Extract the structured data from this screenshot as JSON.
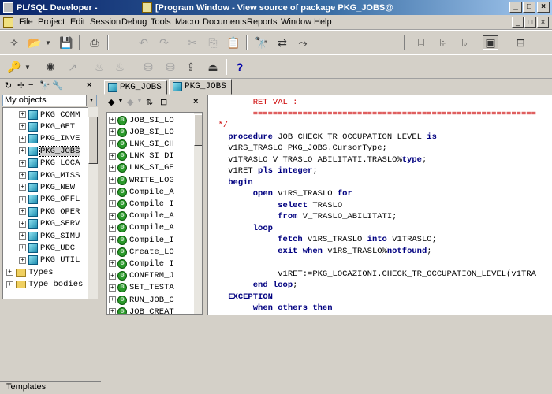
{
  "window": {
    "app_title": "PL/SQL Developer -",
    "doc_title": "[Program Window - View source of package PKG_JOBS@",
    "title_buttons": [
      "_",
      "□",
      "×"
    ]
  },
  "menu": [
    "File",
    "Project",
    "Edit",
    "Session",
    "Debug",
    "Tools",
    "Macro",
    "Documents",
    "Reports",
    "Window",
    "Help"
  ],
  "mdi_buttons": [
    "_",
    "□",
    "×"
  ],
  "toolbar1": [
    "new-icon",
    "open-icon",
    "dropdown-icon",
    "save-icon",
    "print-icon",
    "undo-icon",
    "redo-icon",
    "cut-icon",
    "copy-icon",
    "paste-icon",
    "find-icon",
    "replace-icon",
    "find-next-icon",
    "tool1-icon",
    "tool2-icon",
    "tool3-icon",
    "window-list-icon"
  ],
  "toolbar2": [
    "key-icon",
    "dropdown-icon",
    "settings-icon",
    "disabled-icon",
    "cup-icon",
    "cup2-icon",
    "db-icon",
    "export-icon",
    "import-icon",
    "help-icon"
  ],
  "help_glyph": "?",
  "object_browser": {
    "selector": "My objects",
    "tree": [
      {
        "label": "PKG_COMM",
        "type": "package"
      },
      {
        "label": "PKG_GET",
        "type": "package"
      },
      {
        "label": "PKG_INVE",
        "type": "package"
      },
      {
        "label": "PKG_JOBS",
        "type": "package",
        "selected": true
      },
      {
        "label": "PKG_LOCA",
        "type": "package"
      },
      {
        "label": "PKG_MISS",
        "type": "package"
      },
      {
        "label": "PKG_NEW",
        "type": "package"
      },
      {
        "label": "PKG_OFFL",
        "type": "package"
      },
      {
        "label": "PKG_OPER",
        "type": "package"
      },
      {
        "label": "PKG_SERV",
        "type": "package"
      },
      {
        "label": "PKG_SIMU",
        "type": "package"
      },
      {
        "label": "PKG_UDC",
        "type": "package"
      },
      {
        "label": "PKG_UTIL",
        "type": "package"
      },
      {
        "label": "Types",
        "type": "folder"
      },
      {
        "label": "Type bodies",
        "type": "folder"
      }
    ],
    "bottom_label": "Templates"
  },
  "tabs": [
    {
      "label": "PKG_JOBS",
      "active": false
    },
    {
      "label": "PKG_JOBS",
      "active": true
    }
  ],
  "members": [
    "JOB_SI_LO",
    "JOB_SI_LO",
    "LNK_SI_CH",
    "LNK_SI_DI",
    "LNK_SI_GE",
    "WRITE_LOG",
    "Compile_A",
    "Compile_I",
    "Compile_A",
    "Compile_A",
    "Compile_I",
    "Create_LO",
    "Compile_I",
    "CONFIRM_J",
    "SET_TESTA",
    "RUN_JOB_C",
    "JOB_CREAT"
  ],
  "code": [
    [
      {
        "t": "         RET VAL :",
        "c": "cm"
      }
    ],
    [
      {
        "t": "         =========================================================",
        "c": "cm"
      }
    ],
    [
      {
        "t": "  */",
        "c": "cm"
      }
    ],
    [
      {
        "t": "    ",
        "c": ""
      },
      {
        "t": "procedure",
        "c": "kw"
      },
      {
        "t": " JOB_CHECK_TR_OCCUPATION_LEVEL ",
        "c": ""
      },
      {
        "t": "is",
        "c": "kw"
      }
    ],
    [
      {
        "t": "    v1RS_TRASLO PKG_JOBS.CursorType;",
        "c": ""
      }
    ],
    [
      {
        "t": "    v1TRASLO V_TRASLO_ABILITATI.TRASLO%",
        "c": ""
      },
      {
        "t": "type",
        "c": "kw"
      },
      {
        "t": ";",
        "c": ""
      }
    ],
    [
      {
        "t": "    v1RET ",
        "c": ""
      },
      {
        "t": "pls_integer",
        "c": "kw"
      },
      {
        "t": ";",
        "c": ""
      }
    ],
    [
      {
        "t": "    ",
        "c": ""
      },
      {
        "t": "begin",
        "c": "kw"
      }
    ],
    [
      {
        "t": "         ",
        "c": ""
      },
      {
        "t": "open",
        "c": "kw"
      },
      {
        "t": " v1RS_TRASLO ",
        "c": ""
      },
      {
        "t": "for",
        "c": "kw"
      }
    ],
    [
      {
        "t": "              ",
        "c": ""
      },
      {
        "t": "select",
        "c": "kw"
      },
      {
        "t": " TRASLO",
        "c": ""
      }
    ],
    [
      {
        "t": "              ",
        "c": ""
      },
      {
        "t": "from",
        "c": "kw"
      },
      {
        "t": " V_TRASLO_ABILITATI;",
        "c": ""
      }
    ],
    [
      {
        "t": "         ",
        "c": ""
      },
      {
        "t": "loop",
        "c": "kw"
      }
    ],
    [
      {
        "t": "              ",
        "c": ""
      },
      {
        "t": "fetch",
        "c": "kw"
      },
      {
        "t": " v1RS_TRASLO ",
        "c": ""
      },
      {
        "t": "into",
        "c": "kw"
      },
      {
        "t": " v1TRASLO;",
        "c": ""
      }
    ],
    [
      {
        "t": "              ",
        "c": ""
      },
      {
        "t": "exit when",
        "c": "kw"
      },
      {
        "t": " v1RS_TRASLO%",
        "c": ""
      },
      {
        "t": "notfound",
        "c": "kw"
      },
      {
        "t": ";",
        "c": ""
      }
    ],
    [
      {
        "t": "",
        "c": ""
      }
    ],
    [
      {
        "t": "              v1RET:=PKG_LOCAZIONI.CHECK_TR_OCCUPATION_LEVEL(v1TRA",
        "c": ""
      }
    ],
    [
      {
        "t": "         ",
        "c": ""
      },
      {
        "t": "end loop",
        "c": "kw"
      },
      {
        "t": ";",
        "c": ""
      }
    ],
    [
      {
        "t": "    ",
        "c": ""
      },
      {
        "t": "EXCEPTION",
        "c": "kw"
      }
    ],
    [
      {
        "t": "         ",
        "c": ""
      },
      {
        "t": "when others then",
        "c": "kw"
      }
    ]
  ]
}
